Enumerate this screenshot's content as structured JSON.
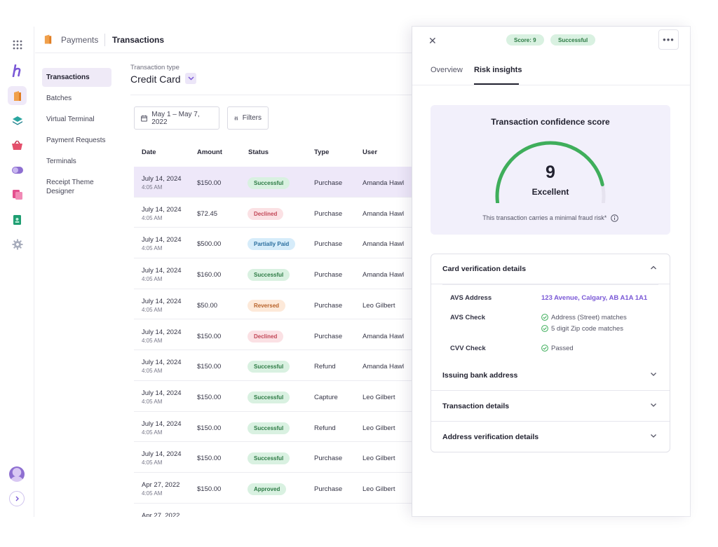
{
  "rail": {
    "items": [
      "apps-grid-icon",
      "brand-logo-icon",
      "payments-icon",
      "layers-icon",
      "basket-icon",
      "toggle-icon",
      "stack-icon",
      "badge-icon",
      "gear-icon"
    ]
  },
  "header": {
    "section": "Payments",
    "page": "Transactions"
  },
  "subnav": {
    "items": [
      {
        "label": "Transactions",
        "active": true
      },
      {
        "label": "Batches"
      },
      {
        "label": "Virtual Terminal"
      },
      {
        "label": "Payment Requests"
      },
      {
        "label": "Terminals"
      },
      {
        "label": "Receipt Theme Designer"
      }
    ]
  },
  "filters": {
    "type_label": "Transaction type",
    "type_value": "Credit Card",
    "date_range": "May 1 – May 7, 2022",
    "filters_label": "Filters"
  },
  "table": {
    "columns": [
      "Date",
      "Amount",
      "Status",
      "Type",
      "User"
    ],
    "rows": [
      {
        "date": "July 14, 2024",
        "time": "4:05 AM",
        "amount": "$150.00",
        "status": "Successful",
        "type": "Purchase",
        "user": "Amanda Hawl"
      },
      {
        "date": "July 14, 2024",
        "time": "4:05 AM",
        "amount": "$72.45",
        "status": "Declined",
        "type": "Purchase",
        "user": "Amanda Hawl"
      },
      {
        "date": "July 14, 2024",
        "time": "4:05 AM",
        "amount": "$500.00",
        "status": "Partially Paid",
        "type": "Purchase",
        "user": "Amanda Hawl"
      },
      {
        "date": "July 14, 2024",
        "time": "4:05 AM",
        "amount": "$160.00",
        "status": "Successful",
        "type": "Purchase",
        "user": "Amanda Hawl"
      },
      {
        "date": "July 14, 2024",
        "time": "4:05 AM",
        "amount": "$50.00",
        "status": "Reversed",
        "type": "Purchase",
        "user": "Leo Gilbert"
      },
      {
        "date": "July 14, 2024",
        "time": "4:05 AM",
        "amount": "$150.00",
        "status": "Declined",
        "type": "Purchase",
        "user": "Amanda Hawl"
      },
      {
        "date": "July 14, 2024",
        "time": "4:05 AM",
        "amount": "$150.00",
        "status": "Successful",
        "type": "Refund",
        "user": "Amanda Hawl"
      },
      {
        "date": "July 14, 2024",
        "time": "4:05 AM",
        "amount": "$150.00",
        "status": "Successful",
        "type": "Capture",
        "user": "Leo Gilbert"
      },
      {
        "date": "July 14, 2024",
        "time": "4:05 AM",
        "amount": "$150.00",
        "status": "Successful",
        "type": "Refund",
        "user": "Leo Gilbert"
      },
      {
        "date": "July 14, 2024",
        "time": "4:05 AM",
        "amount": "$150.00",
        "status": "Successful",
        "type": "Purchase",
        "user": "Leo Gilbert"
      },
      {
        "date": "Apr 27, 2022",
        "time": "4:05 AM",
        "amount": "$150.00",
        "status": "Approved",
        "type": "Purchase",
        "user": "Leo Gilbert"
      },
      {
        "date": "Apr 27, 2022",
        "time": "",
        "amount": "",
        "status": "",
        "type": "",
        "user": ""
      }
    ],
    "status_colors": {
      "Successful": {
        "bg": "#d9f1e1",
        "fg": "#2c7a44"
      },
      "Approved": {
        "bg": "#d9f1e1",
        "fg": "#2c7a44"
      },
      "Declined": {
        "bg": "#fbe1e4",
        "fg": "#c24757"
      },
      "Partially Paid": {
        "bg": "#d6ecfa",
        "fg": "#2b6e9e"
      },
      "Reversed": {
        "bg": "#fde9d9",
        "fg": "#b8622a"
      }
    }
  },
  "panel": {
    "score_pill": "Score: 9",
    "status_pill": "Successful",
    "tabs": [
      {
        "label": "Overview"
      },
      {
        "label": "Risk insights",
        "active": true
      }
    ],
    "score_card": {
      "title": "Transaction confidence score",
      "score": "9",
      "score_fraction": 0.9,
      "rating": "Excellent",
      "note": "This transaction carries a minimal fraud risk*",
      "gauge_color": "#3fae5b"
    },
    "sections": [
      {
        "title": "Card verification details",
        "expanded": true
      },
      {
        "title": "Issuing bank address"
      },
      {
        "title": "Transaction details"
      },
      {
        "title": "Address verification details"
      }
    ],
    "card_verification": {
      "avs_address_label": "AVS Address",
      "avs_address_value": "123 Avenue, Calgary, AB A1A 1A1",
      "avs_check_label": "AVS Check",
      "avs_check_values": [
        "Address (Street) matches",
        "5 digit Zip code matches"
      ],
      "cvv_check_label": "CVV Check",
      "cvv_check_value": "Passed"
    }
  },
  "accent_color": "#7a58d6"
}
